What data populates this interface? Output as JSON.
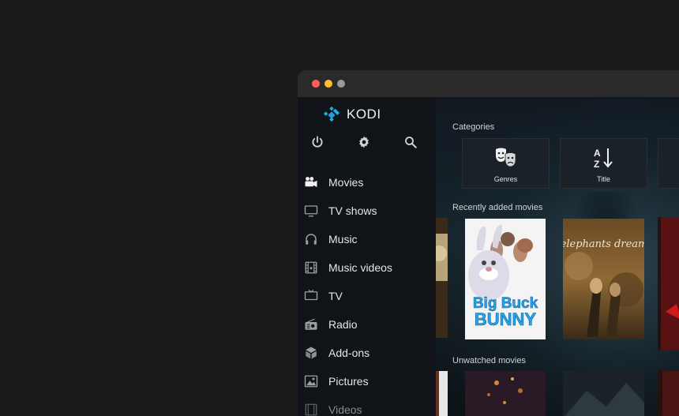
{
  "app": {
    "name": "KODI"
  },
  "window": {
    "controls": [
      "close",
      "minimize",
      "zoom"
    ]
  },
  "sidebar": {
    "top_icons": [
      "power-icon",
      "gear-icon",
      "search-icon"
    ],
    "items": [
      {
        "label": "Movies",
        "icon": "movie-camera-icon"
      },
      {
        "label": "TV shows",
        "icon": "tv-icon"
      },
      {
        "label": "Music",
        "icon": "headphones-icon"
      },
      {
        "label": "Music videos",
        "icon": "film-strip-icon"
      },
      {
        "label": "TV",
        "icon": "tv-icon"
      },
      {
        "label": "Radio",
        "icon": "radio-icon"
      },
      {
        "label": "Add-ons",
        "icon": "box-icon"
      },
      {
        "label": "Pictures",
        "icon": "picture-icon"
      },
      {
        "label": "Videos",
        "icon": "film-strip-icon"
      }
    ]
  },
  "main": {
    "categories": {
      "title": "Categories",
      "items": [
        {
          "label": "Genres",
          "icon": "theater-masks-icon"
        },
        {
          "label": "Title",
          "icon": "sort-az-icon"
        }
      ]
    },
    "recent": {
      "title": "Recently added movies"
    },
    "unwatched": {
      "title": "Unwatched movies"
    },
    "posters": {
      "big_buck_bunny": {
        "line1": "Big Buck",
        "line2": "BUNNY"
      },
      "elephants_dream": {
        "title": "elephants dream"
      }
    }
  },
  "colors": {
    "accent": "#17b2e7",
    "background": "#1b1b1b",
    "sidebar": "#101317"
  }
}
